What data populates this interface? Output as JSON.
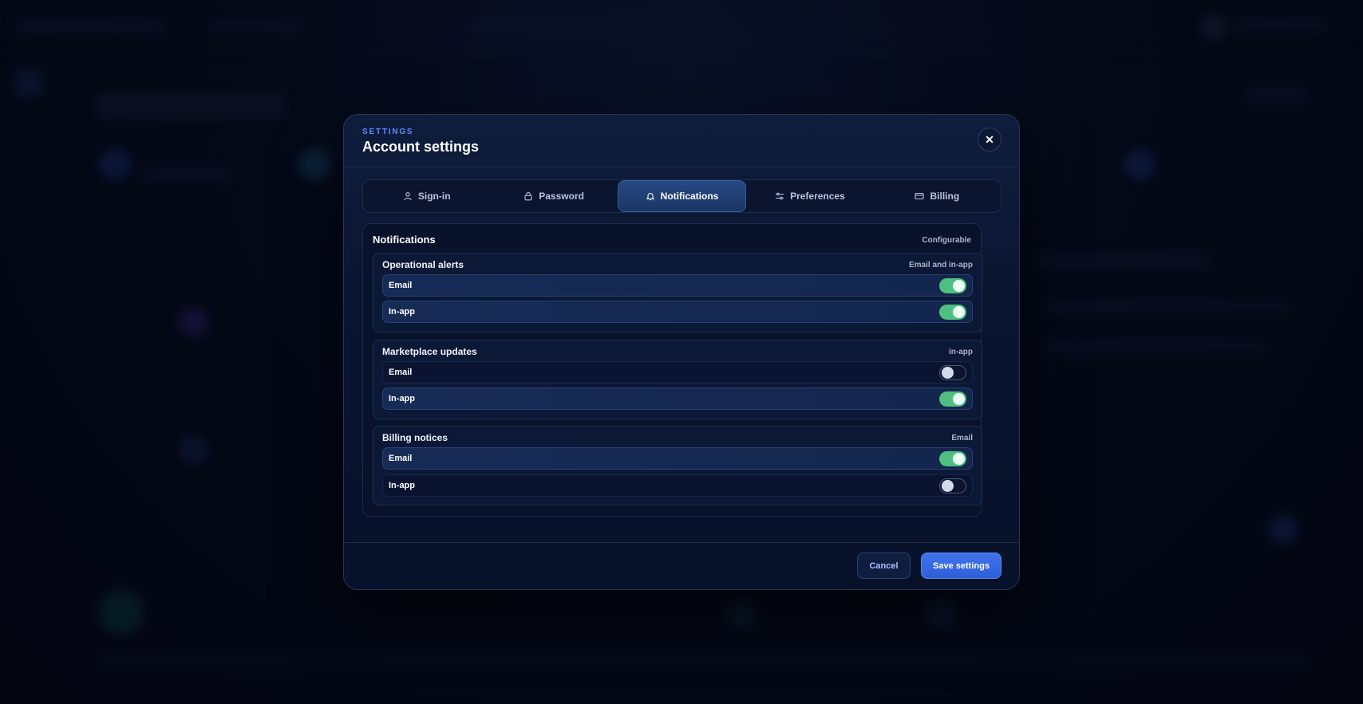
{
  "modal": {
    "eyebrow": "SETTINGS",
    "title": "Account settings",
    "close_label": "✕"
  },
  "tabs": [
    {
      "label": "Sign-in",
      "icon": "user-icon",
      "active": false
    },
    {
      "label": "Password",
      "icon": "lock-icon",
      "active": false
    },
    {
      "label": "Notifications",
      "icon": "bell-icon",
      "active": true
    },
    {
      "label": "Preferences",
      "icon": "sliders-icon",
      "active": false
    },
    {
      "label": "Billing",
      "icon": "card-icon",
      "active": false
    }
  ],
  "notifications": {
    "title": "Notifications",
    "badge": "Configurable",
    "groups": [
      {
        "title": "Operational alerts",
        "meta": "Email and in-app",
        "rows": [
          {
            "label": "Email",
            "enabled": true
          },
          {
            "label": "In-app",
            "enabled": true
          }
        ]
      },
      {
        "title": "Marketplace updates",
        "meta": "in-app",
        "rows": [
          {
            "label": "Email",
            "enabled": false
          },
          {
            "label": "In-app",
            "enabled": true
          }
        ]
      },
      {
        "title": "Billing notices",
        "meta": "Email",
        "rows": [
          {
            "label": "Email",
            "enabled": true
          },
          {
            "label": "In-app",
            "enabled": false
          }
        ]
      }
    ]
  },
  "footer": {
    "cancel_label": "Cancel",
    "save_label": "Save settings"
  },
  "colors": {
    "accent": "#3f73ec",
    "toggle_on": "#4fbf7f",
    "eyebrow": "#5b8cff"
  }
}
